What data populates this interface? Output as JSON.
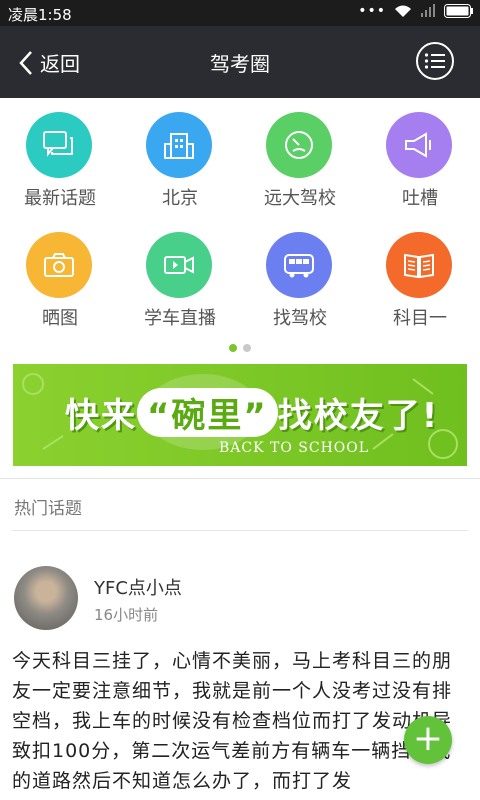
{
  "status": {
    "time": "凌晨1:58"
  },
  "nav": {
    "back_label": "返回",
    "title": "驾考圈",
    "menu_icon": "list-icon"
  },
  "grid": [
    {
      "label": "最新话题",
      "color": "#2ccbc1",
      "icon": "chat-bubbles-icon"
    },
    {
      "label": "北京",
      "color": "#3aa8f0",
      "icon": "building-icon"
    },
    {
      "label": "远大驾校",
      "color": "#59cf66",
      "icon": "speedometer-icon"
    },
    {
      "label": "吐槽",
      "color": "#a57ff0",
      "icon": "megaphone-icon"
    },
    {
      "label": "晒图",
      "color": "#f7b633",
      "icon": "camera-icon"
    },
    {
      "label": "学车直播",
      "color": "#48cf8a",
      "icon": "video-camera-icon"
    },
    {
      "label": "找驾校",
      "color": "#6b7ff0",
      "icon": "bus-icon"
    },
    {
      "label": "科目一",
      "color": "#f36a2a",
      "icon": "book-icon"
    }
  ],
  "pager": {
    "active": 0,
    "total": 2
  },
  "banner": {
    "text_pre": "快来",
    "text_highlight": "“碗里”",
    "text_post": "找校友了!",
    "sub": "BACK TO SCHOOL"
  },
  "section": {
    "title": "热门话题"
  },
  "post": {
    "username": "YFC点小点",
    "time": "16小时前",
    "content": "今天科目三挂了，心情不美丽，马上考科目三的朋友一定要注意细节，我就是前一个人没考过没有排空档，我上车的时候没有检查档位而打了发动机导致扣100分，第二次运气差前方有辆车一辆挡了我的道路然后不知道怎么办了，而打了发"
  },
  "fab": {
    "label": "+"
  }
}
